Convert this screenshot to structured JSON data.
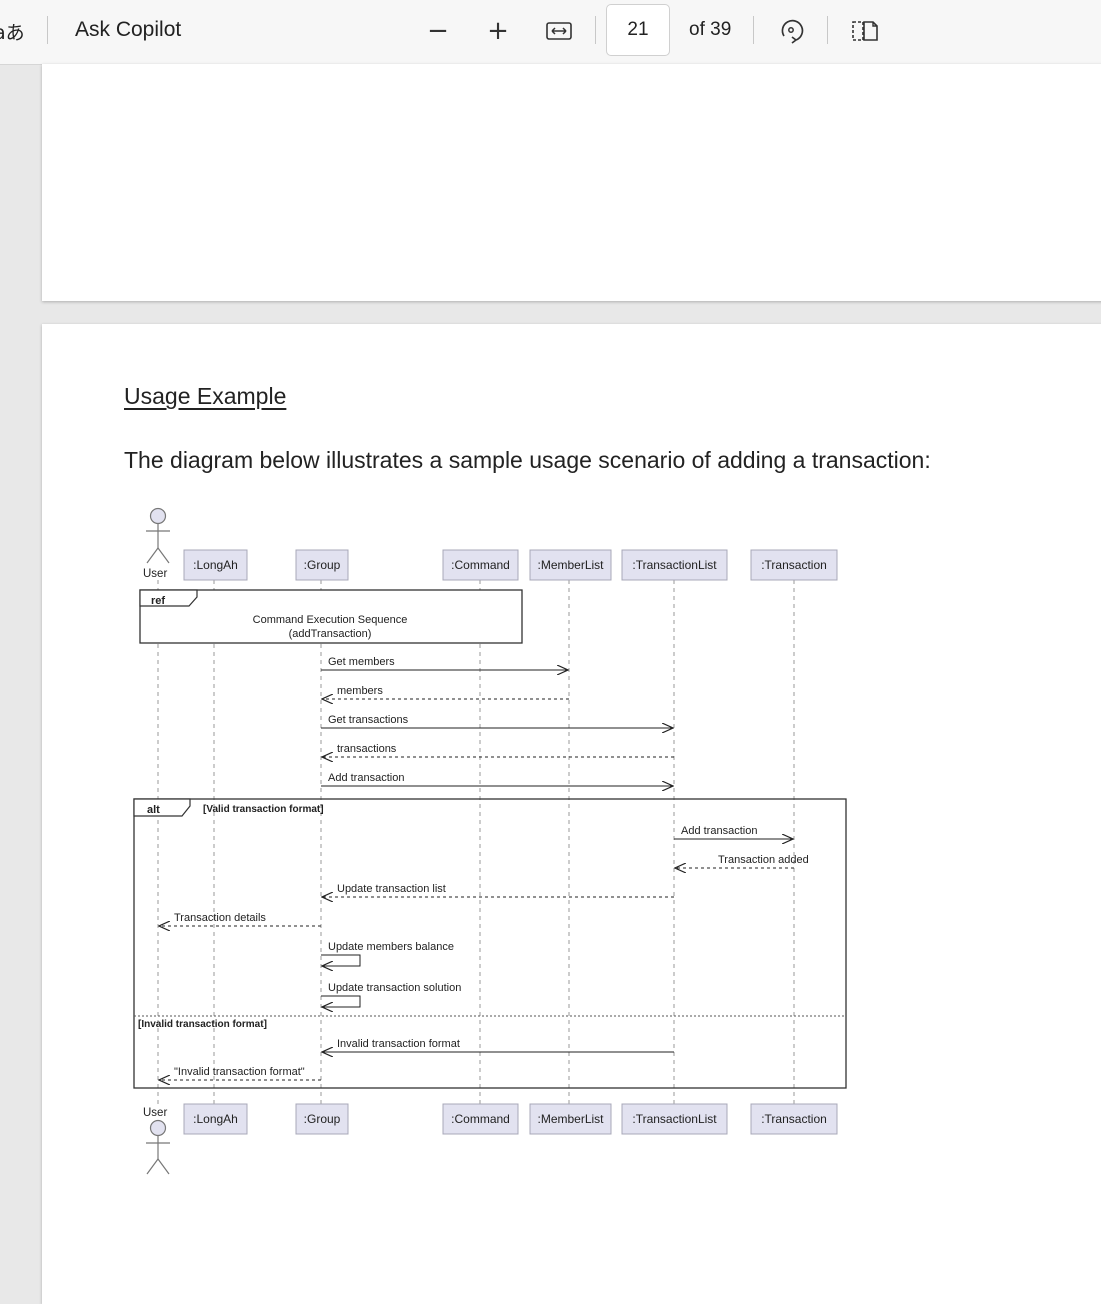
{
  "toolbar": {
    "read_aloud_glyph": "aあ",
    "copilot_label": "Ask Copilot",
    "zoom_out_glyph": "−",
    "zoom_in_glyph": "+",
    "page_number": "21",
    "page_total": "of 39"
  },
  "document": {
    "heading": "Usage Example",
    "paragraph": "The diagram below illustrates a sample usage scenario of adding a transaction:"
  },
  "diagram": {
    "actor": "User",
    "participants": [
      ":LongAh",
      ":Group",
      ":Command",
      ":MemberList",
      ":TransactionList",
      ":Transaction"
    ],
    "ref_tag": "ref",
    "ref_line1": "Command Execution Sequence",
    "ref_line2": "(addTransaction)",
    "alt_tag": "alt",
    "alt_guard": "[Valid transaction format]",
    "else_guard": "[Invalid transaction format]",
    "messages": [
      "Get members",
      "members",
      "Get transactions",
      "transactions",
      "Add transaction",
      "Add transaction",
      "Transaction added",
      "Update transaction list",
      "Transaction details",
      "Update members balance",
      "Update transaction solution",
      "Invalid transaction format",
      "\"Invalid transaction format\""
    ]
  },
  "colors": {
    "participant_fill": "#e2e2f0",
    "participant_border": "#a8a8b8",
    "page_background": "#e8e8e8"
  }
}
